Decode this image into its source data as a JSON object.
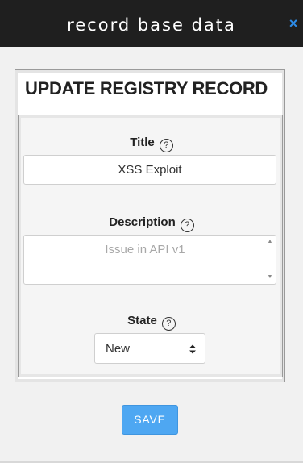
{
  "dialog": {
    "title": "record base data",
    "close_glyph": "×"
  },
  "panel": {
    "heading": "UPDATE REGISTRY RECORD"
  },
  "fields": {
    "title": {
      "label": "Title",
      "help_glyph": "?",
      "value": "XSS Exploit"
    },
    "description": {
      "label": "Description",
      "help_glyph": "?",
      "placeholder": "Issue in API v1",
      "value": ""
    },
    "state": {
      "label": "State",
      "help_glyph": "?",
      "selected": "New"
    }
  },
  "actions": {
    "save_label": "SAVE"
  },
  "colors": {
    "header_bg": "#1f1f1f",
    "close_icon": "#2d8ce8",
    "save_button": "#4ea7f2"
  },
  "icons": {
    "close": "close-icon",
    "help": "help-circle-icon",
    "select": "sort-arrows-icon"
  }
}
